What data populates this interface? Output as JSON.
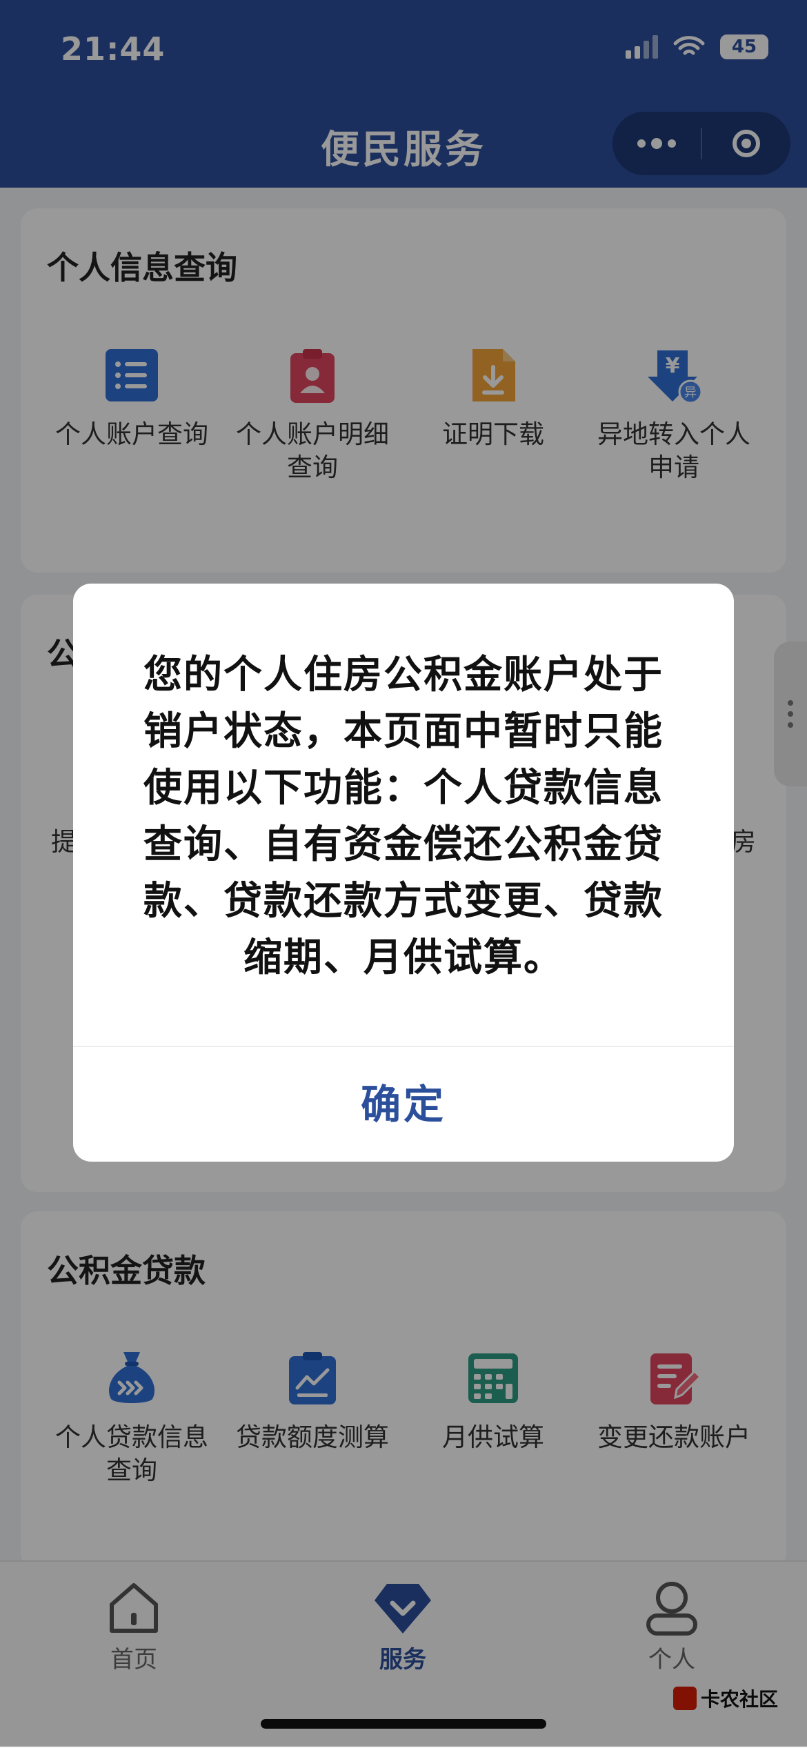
{
  "status_bar": {
    "time": "21:44",
    "battery": "45"
  },
  "nav": {
    "title": "便民服务"
  },
  "sections": [
    {
      "title": "个人信息查询",
      "items": [
        {
          "label": "个人账户查询",
          "icon": "account-list-icon"
        },
        {
          "label": "个人账户明细查询",
          "icon": "account-detail-icon"
        },
        {
          "label": "证明下载",
          "icon": "certificate-download-icon"
        },
        {
          "label": "异地转入个人申请",
          "icon": "remote-transfer-icon"
        }
      ]
    },
    {
      "title": "公",
      "items": [
        {
          "label": "提",
          "icon": "withdraw-icon"
        },
        {
          "label": "房",
          "icon": "house-icon"
        }
      ]
    },
    {
      "title": "公积金贷款",
      "items": [
        {
          "label": "个人贷款信息查询",
          "icon": "loan-bag-icon"
        },
        {
          "label": "贷款额度测算",
          "icon": "loan-quota-icon"
        },
        {
          "label": "月供试算",
          "icon": "calculator-icon"
        },
        {
          "label": "变更还款账户",
          "icon": "edit-account-icon"
        }
      ]
    }
  ],
  "tabbar": {
    "items": [
      {
        "label": "首页",
        "icon": "home-icon"
      },
      {
        "label": "服务",
        "icon": "service-diamond-icon"
      },
      {
        "label": "个人",
        "icon": "person-icon"
      }
    ]
  },
  "watermark": "卡农社区",
  "dialog": {
    "message": "您的个人住房公积金账户处于销户状态，本页面中暂时只能使用以下功能：个人贷款信息查询、自有资金偿还公积金贷款、贷款还款方式变更、贷款缩期、月供试算。",
    "confirm": "确定"
  },
  "colors": {
    "primary": "#2c4f9b",
    "blue_icon": "#2f6fd6",
    "red_icon": "#e0455e",
    "orange_icon": "#f2a43a",
    "green_icon": "#2e9c83"
  }
}
